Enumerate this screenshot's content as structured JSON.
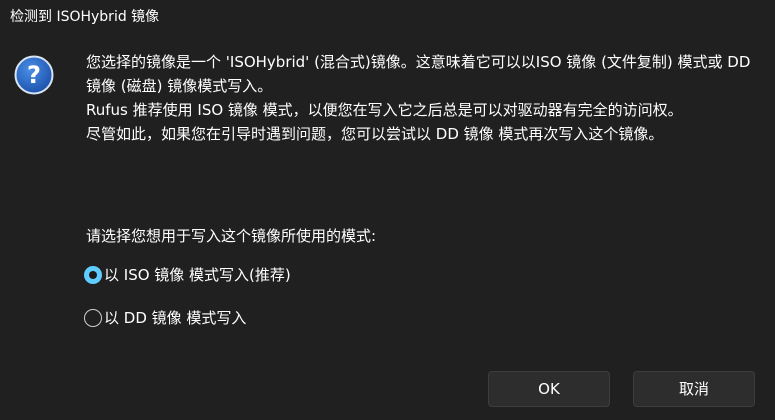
{
  "window": {
    "title": "检测到 ISOHybrid 镜像"
  },
  "icon": {
    "name": "question-icon",
    "glyph": "?",
    "color": "#1f5fb8"
  },
  "message": {
    "paragraphs": [
      "您选择的镜像是一个 'ISOHybrid' (混合式)镜像。这意味着它可以以ISO 镜像 (文件复制) 模式或 DD 镜像 (磁盘) 镜像模式写入。",
      "Rufus 推荐使用 ISO 镜像 模式，以便您在写入它之后总是可以对驱动器有完全的访问权。",
      "尽管如此，如果您在引导时遇到问题，您可以尝试以 DD 镜像 模式再次写入这个镜像。"
    ]
  },
  "prompt": "请选择您想用于写入这个镜像所使用的模式:",
  "options": [
    {
      "label": "以 ISO 镜像 模式写入(推荐)",
      "checked": true
    },
    {
      "label": "以 DD 镜像 模式写入",
      "checked": false
    }
  ],
  "buttons": {
    "ok": "OK",
    "cancel": "取消"
  },
  "colors": {
    "background": "#202020",
    "text": "#ffffff",
    "accent": "#60cdff",
    "button_bg": "#2d2d2d"
  }
}
